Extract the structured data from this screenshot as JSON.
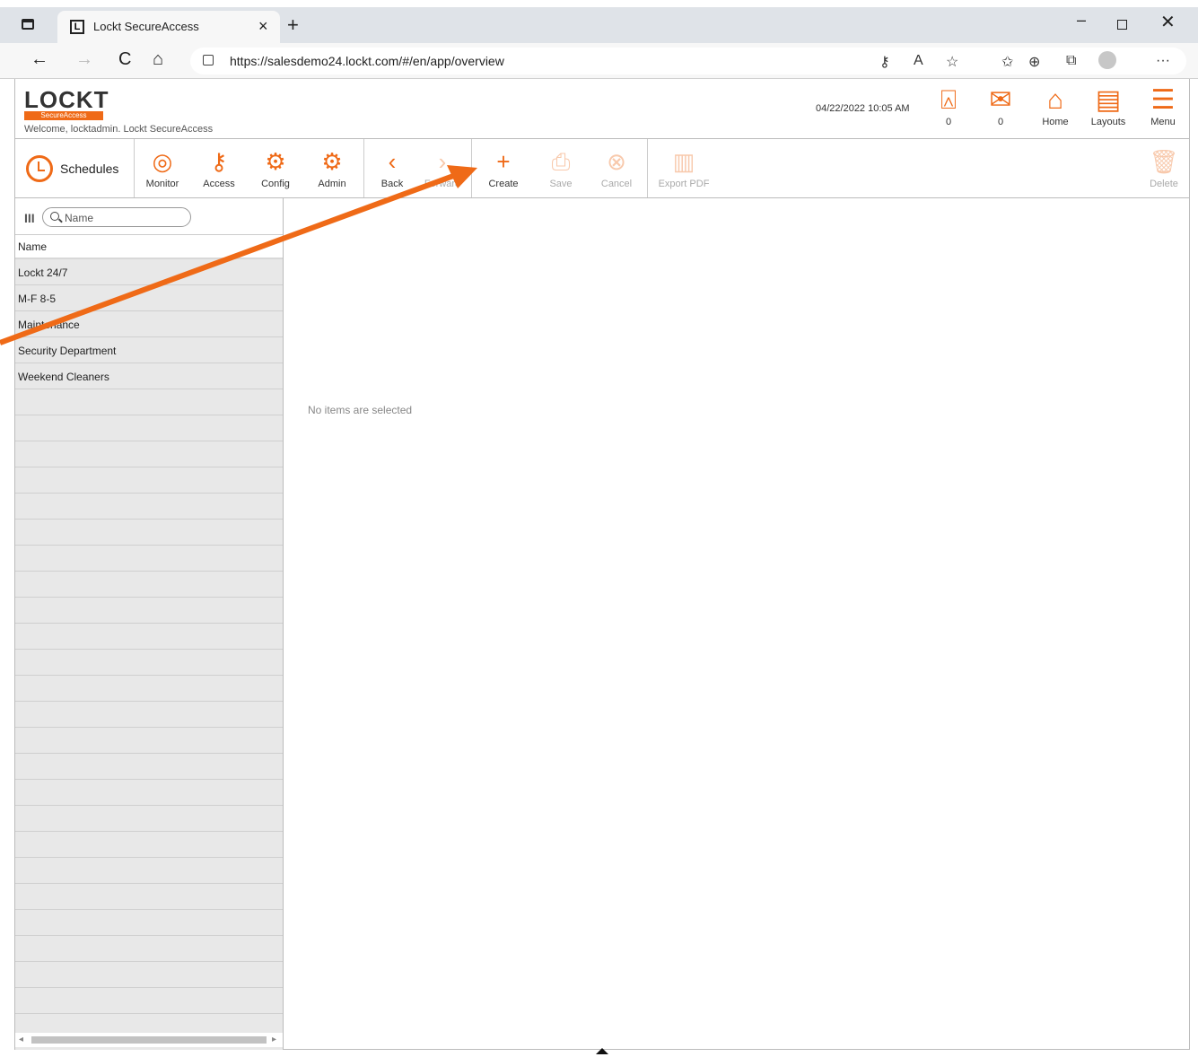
{
  "browser": {
    "tab_title": "Lockt SecureAccess",
    "favicon_letter": "L",
    "tab_close": "×",
    "new_tab": "+",
    "url": "https://salesdemo24.lockt.com/#/en/app/overview",
    "nav": {
      "back": "←",
      "forward": "→",
      "refresh": "C",
      "home": "⌂"
    },
    "window": {
      "minimize": "–",
      "close": "✕"
    },
    "icons": [
      "key-icon",
      "read-aloud-icon",
      "add-favorite-icon",
      "favorites-icon",
      "collections-icon",
      "extensions-icon",
      "profile-icon",
      "more-icon"
    ],
    "icon_glyphs": {
      "key": "⚷",
      "read_aloud": "A",
      "add_favorite": "☆",
      "favorites": "✩",
      "collections": "⊕",
      "extensions": "⧉",
      "more": "···"
    }
  },
  "header": {
    "logo": "LOCKT",
    "logo_sub": "SecureAccess",
    "welcome": "Welcome, locktadmin.  Lockt SecureAccess",
    "datetime": "04/22/2022 10:05 AM",
    "buttons": [
      {
        "label": "0",
        "icon": "alarm-icon",
        "glyph": "⍓"
      },
      {
        "label": "0",
        "icon": "mail-icon",
        "glyph": "✉"
      },
      {
        "label": "Home",
        "icon": "home-icon",
        "glyph": "⌂"
      },
      {
        "label": "Layouts",
        "icon": "layouts-icon",
        "glyph": "▤"
      },
      {
        "label": "Menu",
        "icon": "menu-icon",
        "glyph": "☰"
      }
    ]
  },
  "toolbar": {
    "module": "Schedules",
    "modules": [
      {
        "label": "Monitor",
        "glyph": "◎"
      },
      {
        "label": "Access",
        "glyph": "⚷"
      },
      {
        "label": "Config",
        "glyph": "⚙"
      },
      {
        "label": "Admin",
        "glyph": "⚙"
      }
    ],
    "nav": [
      {
        "label": "Back",
        "glyph": "‹"
      },
      {
        "label": "Forward",
        "glyph": "›"
      }
    ],
    "actions": [
      {
        "label": "Create",
        "glyph": "+"
      },
      {
        "label": "Save",
        "glyph": "⎙"
      },
      {
        "label": "Cancel",
        "glyph": "⊗"
      }
    ],
    "export": {
      "label": "Export PDF",
      "glyph": "▥"
    },
    "delete": {
      "label": "Delete",
      "glyph": "🗑"
    }
  },
  "list": {
    "columns_icon": "III",
    "search_placeholder": "Name",
    "column_header": "Name",
    "rows": [
      "Lockt 24/7",
      "M-F 8-5",
      "Maintenance",
      "Security Department",
      "Weekend Cleaners"
    ],
    "scroll_left": "◂",
    "scroll_right": "▸"
  },
  "detail": {
    "empty_message": "No items are selected"
  },
  "colors": {
    "accent": "#ef6a17",
    "accent_disabled": "#f8c9ac",
    "list_bg": "#e8e8e8"
  }
}
